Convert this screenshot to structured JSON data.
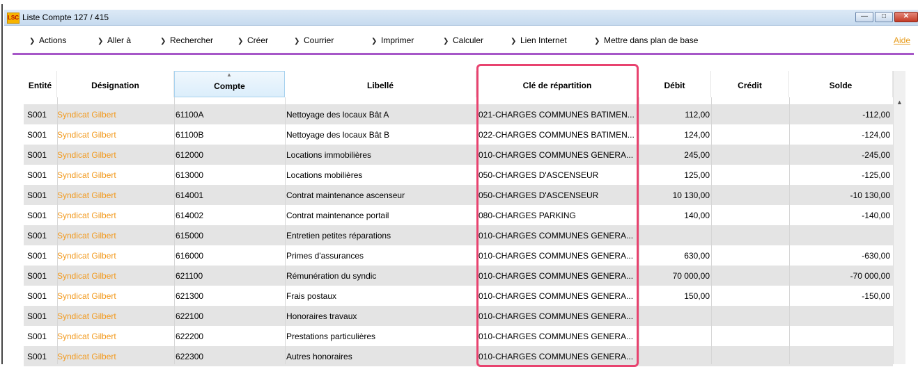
{
  "window": {
    "app_icon": "LSC",
    "title": "Liste  Compte 127 / 415",
    "controls": [
      "minimize-icon",
      "maximize-icon",
      "close-icon"
    ]
  },
  "toolbar": {
    "items": [
      {
        "label": "Actions",
        "icon": "chevron-down-icon"
      },
      {
        "label": "Aller à",
        "icon": "chevron-down-icon"
      },
      {
        "label": "Rechercher",
        "icon": "chevron-right-icon"
      },
      {
        "label": "Créer",
        "icon": "chevron-right-icon"
      },
      {
        "label": "Courrier",
        "icon": "chevron-right-icon"
      },
      {
        "label": "Imprimer",
        "icon": "chevron-down-icon"
      },
      {
        "label": "Calculer",
        "icon": "chevron-down-icon"
      },
      {
        "label": "Lien Internet",
        "icon": "chevron-down-icon"
      },
      {
        "label": "Mettre dans plan de base",
        "icon": "chevron-right-icon"
      }
    ],
    "help_label": "Aide",
    "accent_color": "#a657c8"
  },
  "table": {
    "columns": [
      "Entité",
      "Désignation",
      "Compte",
      "Libellé",
      "Clé de répartition",
      "Débit",
      "Crédit",
      "Solde"
    ],
    "sorted_column": "Compte",
    "rows": [
      [
        "S001",
        "Syndicat Gilbert",
        "61100A",
        "Nettoyage des locaux Bât A",
        "021-CHARGES COMMUNES BATIMEN...",
        "112,00",
        "",
        "-112,00"
      ],
      [
        "S001",
        "Syndicat Gilbert",
        "61100B",
        "Nettoyage des locaux Bât B",
        "022-CHARGES COMMUNES BATIMEN...",
        "124,00",
        "",
        "-124,00"
      ],
      [
        "S001",
        "Syndicat Gilbert",
        "612000",
        "Locations immobilières",
        "010-CHARGES COMMUNES GENERA...",
        "245,00",
        "",
        "-245,00"
      ],
      [
        "S001",
        "Syndicat Gilbert",
        "613000",
        "Locations mobilières",
        "050-CHARGES D'ASCENSEUR",
        "125,00",
        "",
        "-125,00"
      ],
      [
        "S001",
        "Syndicat Gilbert",
        "614001",
        "Contrat maintenance ascenseur",
        "050-CHARGES D'ASCENSEUR",
        "10 130,00",
        "",
        "-10 130,00"
      ],
      [
        "S001",
        "Syndicat Gilbert",
        "614002",
        "Contrat maintenance portail",
        "080-CHARGES PARKING",
        "140,00",
        "",
        "-140,00"
      ],
      [
        "S001",
        "Syndicat Gilbert",
        "615000",
        "Entretien  petites réparations",
        "010-CHARGES COMMUNES GENERA...",
        "",
        "",
        ""
      ],
      [
        "S001",
        "Syndicat Gilbert",
        "616000",
        "Primes d'assurances",
        "010-CHARGES COMMUNES GENERA...",
        "630,00",
        "",
        "-630,00"
      ],
      [
        "S001",
        "Syndicat Gilbert",
        "621100",
        "Rémunération du syndic",
        "010-CHARGES COMMUNES GENERA...",
        "70 000,00",
        "",
        "-70 000,00"
      ],
      [
        "S001",
        "Syndicat Gilbert",
        "621300",
        "Frais postaux",
        "010-CHARGES COMMUNES GENERA...",
        "150,00",
        "",
        "-150,00"
      ],
      [
        "S001",
        "Syndicat Gilbert",
        "622100",
        "Honoraires travaux",
        "010-CHARGES COMMUNES GENERA...",
        "",
        "",
        ""
      ],
      [
        "S001",
        "Syndicat Gilbert",
        "622200",
        "Prestations particulières",
        "010-CHARGES COMMUNES GENERA...",
        "",
        "",
        ""
      ],
      [
        "S001",
        "Syndicat Gilbert",
        "622300",
        "Autres honoraires",
        "010-CHARGES COMMUNES GENERA...",
        "",
        "",
        ""
      ]
    ],
    "highlight_color": "#e8436f",
    "designation_color": "#f29a1f"
  }
}
